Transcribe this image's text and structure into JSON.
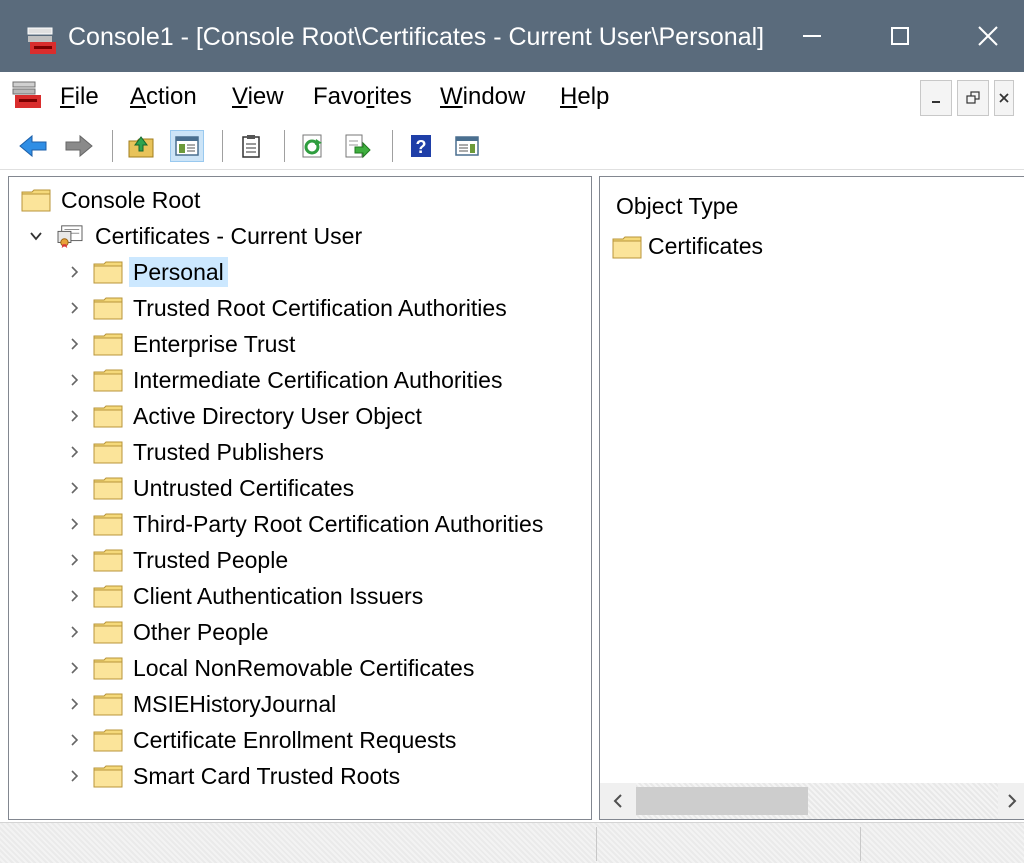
{
  "window": {
    "title": "Console1 - [Console Root\\Certificates - Current User\\Personal]"
  },
  "menu": {
    "items": [
      {
        "accel": "F",
        "rest": "ile"
      },
      {
        "accel": "A",
        "rest": "ction"
      },
      {
        "accel": "V",
        "rest": "iew"
      },
      {
        "pre": "Favo",
        "accel": "r",
        "rest": "ites"
      },
      {
        "accel": "W",
        "rest": "indow"
      },
      {
        "accel": "H",
        "rest": "elp"
      }
    ]
  },
  "toolbar": {
    "icons": [
      "back-arrow-icon",
      "forward-arrow-icon",
      "up-one-level-icon",
      "show-hide-console-tree-icon",
      "properties-icon",
      "refresh-icon",
      "export-list-icon",
      "help-icon",
      "show-hide-action-pane-icon"
    ]
  },
  "tree": {
    "root": "Console Root",
    "snapin": "Certificates - Current User",
    "stores": [
      "Personal",
      "Trusted Root Certification Authorities",
      "Enterprise Trust",
      "Intermediate Certification Authorities",
      "Active Directory User Object",
      "Trusted Publishers",
      "Untrusted Certificates",
      "Third-Party Root Certification Authorities",
      "Trusted People",
      "Client Authentication Issuers",
      "Other People",
      "Local NonRemovable Certificates",
      "MSIEHistoryJournal",
      "Certificate Enrollment Requests",
      "Smart Card Trusted Roots"
    ],
    "selected": "Personal"
  },
  "details": {
    "column_header": "Object Type",
    "items": [
      "Certificates"
    ]
  },
  "colors": {
    "titlebar": "#5a6b7c",
    "selection": "#cce8ff",
    "folder": "#f5d97a"
  }
}
